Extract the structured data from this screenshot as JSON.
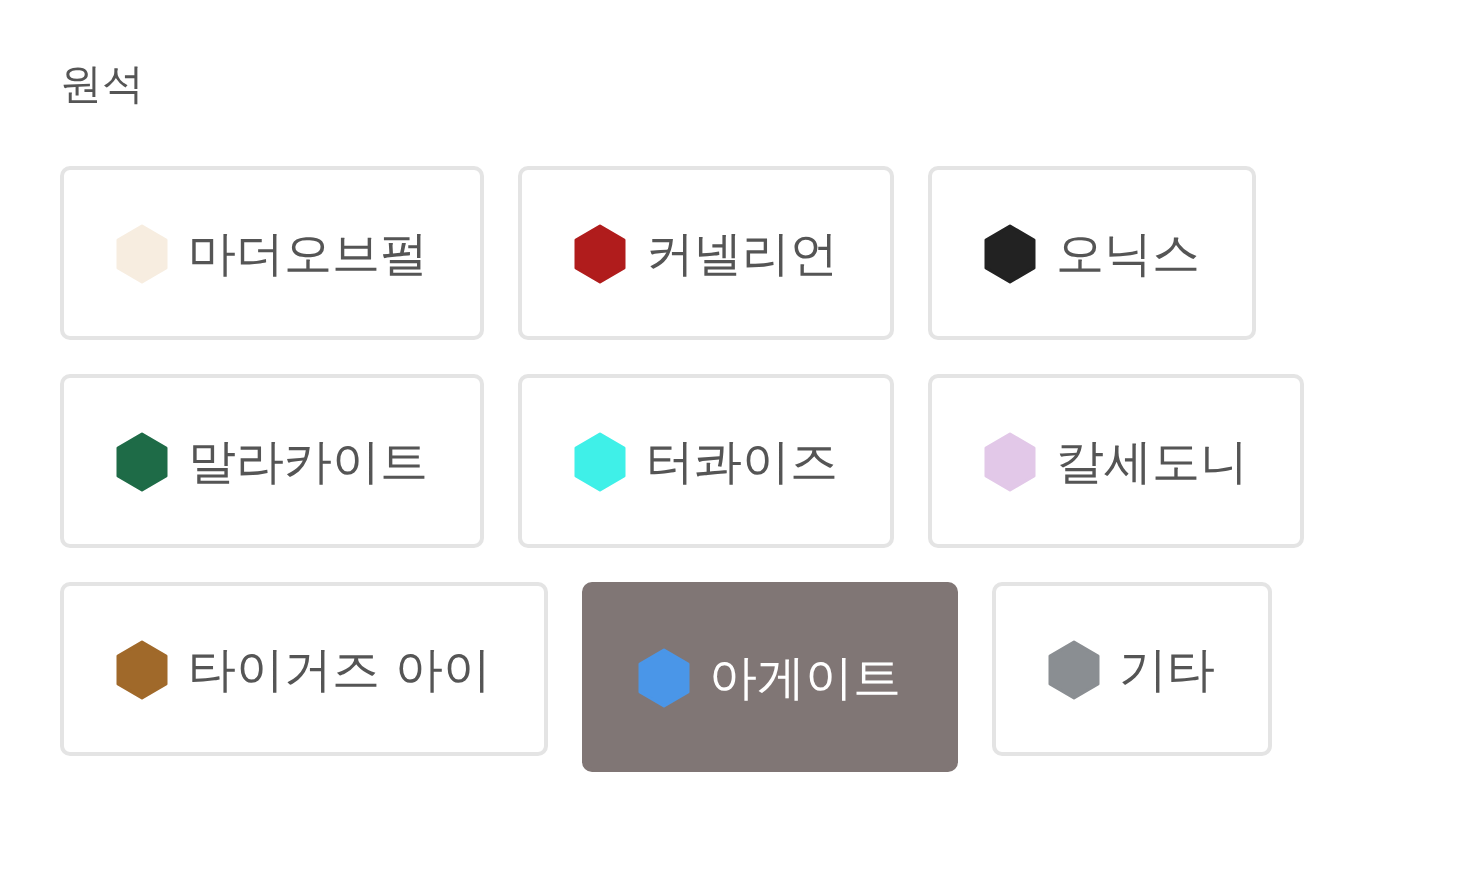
{
  "title": "원석",
  "options": [
    {
      "label": "마더오브펄",
      "color": "#f7ede0",
      "selected": false
    },
    {
      "label": "커넬리언",
      "color": "#b01c1c",
      "selected": false
    },
    {
      "label": "오닉스",
      "color": "#222222",
      "selected": false
    },
    {
      "label": "말라카이트",
      "color": "#1e6b47",
      "selected": false
    },
    {
      "label": "터콰이즈",
      "color": "#3ff0e8",
      "selected": false
    },
    {
      "label": "칼세도니",
      "color": "#e2c8e8",
      "selected": false
    },
    {
      "label": "타이거즈 아이",
      "color": "#a0692a",
      "selected": false
    },
    {
      "label": "아게이트",
      "color": "#4a96e8",
      "selected": true
    },
    {
      "label": "기타",
      "color": "#8a8e92",
      "selected": false
    }
  ]
}
